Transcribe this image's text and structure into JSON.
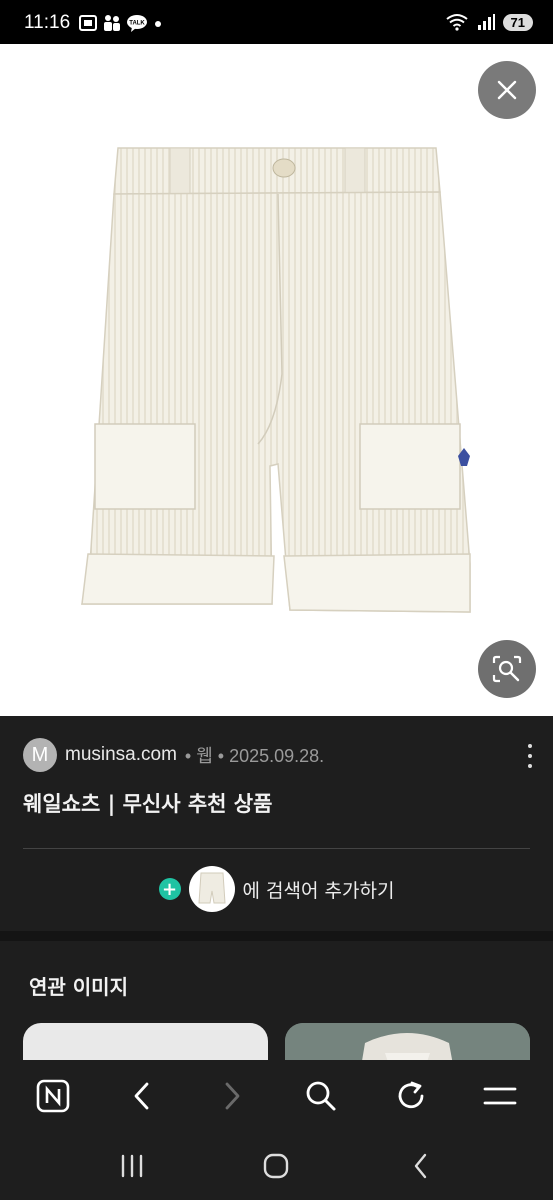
{
  "status_bar": {
    "time": "11:16",
    "battery": "71",
    "left_icons": [
      "screenshot-icon",
      "family-icon",
      "kakaotalk-icon",
      "dot-icon"
    ],
    "right_icons": [
      "wifi-icon",
      "signal-icon"
    ]
  },
  "image_viewer": {
    "subject": "white corduroy shorts",
    "buttons": [
      "close-icon",
      "lens-search-icon"
    ]
  },
  "result": {
    "avatar_letter": "M",
    "site": "musinsa.com",
    "meta": " • 웹 • 2025.09.28.",
    "title": "웨일쇼츠 | 무신사 추천 상품"
  },
  "add_search": {
    "label": "에 검색어 추가하기"
  },
  "related": {
    "title": "연관 이미지"
  },
  "toolbar": {
    "items": [
      "naver-home-icon",
      "back-icon",
      "forward-icon",
      "search-icon",
      "refresh-icon",
      "menu-icon"
    ]
  },
  "system_nav": {
    "items": [
      "recent-apps-icon",
      "home-icon",
      "back-icon"
    ]
  },
  "colors": {
    "panel": "#1e1e1e",
    "accent_plus": "#1fc3a3",
    "close_button": "#7a7a7a"
  }
}
